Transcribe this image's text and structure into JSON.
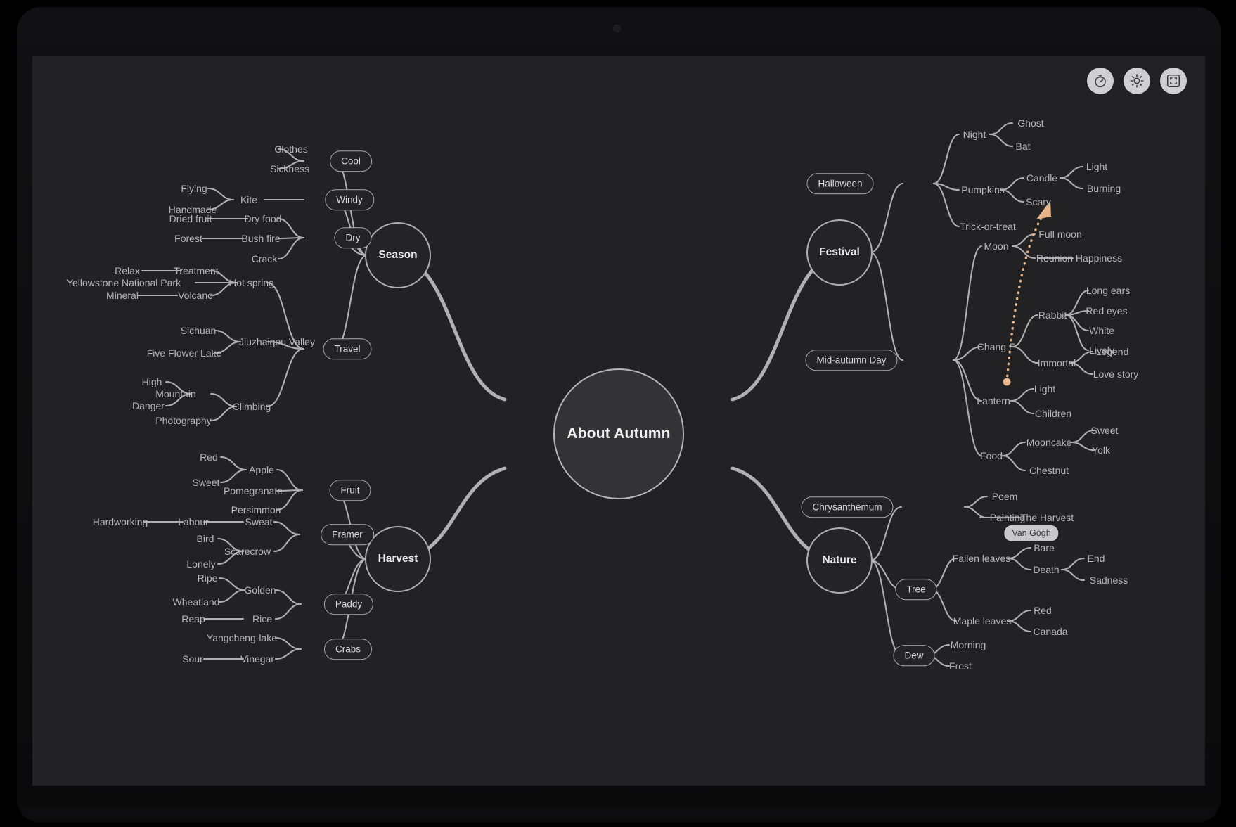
{
  "app": {
    "root_label": "About Autumn",
    "toolbar": [
      {
        "name": "timer-icon",
        "label": "Timer"
      },
      {
        "name": "brightness-icon",
        "label": "Brightness"
      },
      {
        "name": "fit-screen-icon",
        "label": "Fit to screen"
      }
    ],
    "colors": {
      "background": "#222224",
      "edge": "#b0b0b2",
      "text": "#b6b6ba",
      "accent": "#e8b68a",
      "badge_bg": "#c8c8cc"
    }
  },
  "relation": {
    "from": "Light",
    "to": "Light",
    "style": "dotted-arrow",
    "color": "#e8b68a"
  },
  "branches": {
    "season": {
      "label": "Season",
      "groups": [
        {
          "label": "Cool",
          "children": [
            {
              "label": "Clothes"
            },
            {
              "label": "Sickness"
            }
          ]
        },
        {
          "label": "Windy",
          "children": [
            {
              "label": "Kite",
              "children": [
                {
                  "label": "Flying"
                },
                {
                  "label": "Handmade"
                }
              ]
            }
          ]
        },
        {
          "label": "Dry",
          "children": [
            {
              "label": "Dry food",
              "children": [
                {
                  "label": "Dried fruit"
                }
              ]
            },
            {
              "label": "Bush fire",
              "children": [
                {
                  "label": "Forest"
                }
              ]
            },
            {
              "label": "Crack"
            }
          ]
        },
        {
          "label": "Travel",
          "children": [
            {
              "label": "Hot spring",
              "children": [
                {
                  "label": "Treatment",
                  "children": [
                    {
                      "label": "Relax"
                    }
                  ]
                },
                {
                  "label": "Yellowstone National Park"
                },
                {
                  "label": "Volcano",
                  "children": [
                    {
                      "label": "Mineral"
                    }
                  ]
                }
              ]
            },
            {
              "label": "Jiuzhaigou Valley",
              "children": [
                {
                  "label": "Sichuan"
                },
                {
                  "label": "Five Flower Lake"
                }
              ]
            },
            {
              "label": "Climbing",
              "children": [
                {
                  "label": "Mountain",
                  "children": [
                    {
                      "label": "High"
                    },
                    {
                      "label": "Danger"
                    }
                  ]
                },
                {
                  "label": "Photography"
                }
              ]
            }
          ]
        }
      ]
    },
    "harvest": {
      "label": "Harvest",
      "groups": [
        {
          "label": "Fruit",
          "children": [
            {
              "label": "Apple",
              "children": [
                {
                  "label": "Red"
                },
                {
                  "label": "Sweet"
                }
              ]
            },
            {
              "label": "Pomegranate"
            },
            {
              "label": "Persimmon"
            }
          ]
        },
        {
          "label": "Framer",
          "children": [
            {
              "label": "Sweat",
              "children": [
                {
                  "label": "Labour",
                  "children": [
                    {
                      "label": "Hardworking"
                    }
                  ]
                }
              ]
            },
            {
              "label": "Scarecrow",
              "children": [
                {
                  "label": "Bird"
                },
                {
                  "label": "Lonely"
                }
              ]
            }
          ]
        },
        {
          "label": "Paddy",
          "children": [
            {
              "label": "Golden",
              "children": [
                {
                  "label": "Ripe"
                },
                {
                  "label": "Wheatland"
                }
              ]
            },
            {
              "label": "Rice",
              "children": [
                {
                  "label": "Reap"
                }
              ]
            }
          ]
        },
        {
          "label": "Crabs",
          "children": [
            {
              "label": "Yangcheng-lake"
            },
            {
              "label": "Vinegar",
              "children": [
                {
                  "label": "Sour"
                }
              ]
            }
          ]
        }
      ]
    },
    "festival": {
      "label": "Festival",
      "groups": [
        {
          "label": "Halloween",
          "children": [
            {
              "label": "Night",
              "children": [
                {
                  "label": "Ghost"
                },
                {
                  "label": "Bat"
                }
              ]
            },
            {
              "label": "Pumpkins",
              "children": [
                {
                  "label": "Candle",
                  "children": [
                    {
                      "label": "Light"
                    },
                    {
                      "label": "Burning"
                    }
                  ]
                },
                {
                  "label": "Scary"
                }
              ]
            },
            {
              "label": "Trick-or-treat"
            }
          ]
        },
        {
          "label": "Mid-autumn Day",
          "children": [
            {
              "label": "Moon",
              "children": [
                {
                  "label": "Full moon"
                },
                {
                  "label": "Reunion",
                  "children": [
                    {
                      "label": "Happiness"
                    }
                  ]
                }
              ]
            },
            {
              "label": "Chang E",
              "children": [
                {
                  "label": "Rabbit",
                  "children": [
                    {
                      "label": "Long ears"
                    },
                    {
                      "label": "Red eyes"
                    },
                    {
                      "label": "White"
                    },
                    {
                      "label": "Lively"
                    }
                  ]
                },
                {
                  "label": "Immortal",
                  "children": [
                    {
                      "label": "Legend"
                    },
                    {
                      "label": "Love story"
                    }
                  ]
                }
              ]
            },
            {
              "label": "Lantern",
              "children": [
                {
                  "label": "Light"
                },
                {
                  "label": "Children"
                }
              ]
            },
            {
              "label": "Food",
              "children": [
                {
                  "label": "Mooncake",
                  "children": [
                    {
                      "label": "Sweet"
                    },
                    {
                      "label": "Yolk"
                    }
                  ]
                },
                {
                  "label": "Chestnut"
                }
              ]
            }
          ]
        }
      ]
    },
    "nature": {
      "label": "Nature",
      "groups": [
        {
          "label": "Chrysanthemum",
          "children": [
            {
              "label": "Poem"
            },
            {
              "label": "Painting",
              "children": [
                {
                  "label": "The Harvest",
                  "badge": "Van Gogh"
                }
              ]
            }
          ]
        },
        {
          "label": "Tree",
          "children": [
            {
              "label": "Fallen leaves",
              "children": [
                {
                  "label": "Bare"
                },
                {
                  "label": "Death",
                  "children": [
                    {
                      "label": "End"
                    },
                    {
                      "label": "Sadness"
                    }
                  ]
                }
              ]
            },
            {
              "label": "Maple leaves",
              "children": [
                {
                  "label": "Red"
                },
                {
                  "label": "Canada"
                }
              ]
            }
          ]
        },
        {
          "label": "Dew",
          "children": [
            {
              "label": "Morning"
            },
            {
              "label": "Frost"
            }
          ]
        }
      ]
    }
  },
  "nodes": {
    "root": "About Autumn",
    "season": "Season",
    "harvest": "Harvest",
    "festival": "Festival",
    "nature": "Nature",
    "cool": "Cool",
    "windy": "Windy",
    "dry": "Dry",
    "travel": "Travel",
    "clothes": "Clothes",
    "sickness": "Sickness",
    "kite": "Kite",
    "flying": "Flying",
    "handmade": "Handmade",
    "dryfood": "Dry food",
    "driedfruit": "Dried fruit",
    "bushfire": "Bush fire",
    "forest": "Forest",
    "crack": "Crack",
    "hotspring": "Hot spring",
    "treatment": "Treatment",
    "relax": "Relax",
    "yellowstone": "Yellowstone National Park",
    "volcano": "Volcano",
    "mineral": "Mineral",
    "jiuzhaigou": "Jiuzhaigou Valley",
    "sichuan": "Sichuan",
    "fiveflower": "Five Flower Lake",
    "climbing": "Climbing",
    "mountain": "Mountain",
    "high": "High",
    "danger": "Danger",
    "photography": "Photography",
    "fruit": "Fruit",
    "apple": "Apple",
    "red1": "Red",
    "sweet1": "Sweet",
    "pomegranate": "Pomegranate",
    "persimmon": "Persimmon",
    "framer": "Framer",
    "sweat": "Sweat",
    "labour": "Labour",
    "hardworking": "Hardworking",
    "scarecrow": "Scarecrow",
    "bird": "Bird",
    "lonely": "Lonely",
    "paddy": "Paddy",
    "golden": "Golden",
    "ripe": "Ripe",
    "wheatland": "Wheatland",
    "rice": "Rice",
    "reap": "Reap",
    "crabs": "Crabs",
    "yangcheng": "Yangcheng-lake",
    "vinegar": "Vinegar",
    "sour": "Sour",
    "halloween": "Halloween",
    "night": "Night",
    "ghost": "Ghost",
    "bat": "Bat",
    "pumpkins": "Pumpkins",
    "candle": "Candle",
    "light1": "Light",
    "burning": "Burning",
    "scary": "Scary",
    "trick": "Trick-or-treat",
    "midautumn": "Mid-autumn Day",
    "moon": "Moon",
    "fullmoon": "Full moon",
    "reunion": "Reunion",
    "happiness": "Happiness",
    "change": "Chang E",
    "rabbit": "Rabbit",
    "longears": "Long ears",
    "redeyes": "Red eyes",
    "white": "White",
    "lively": "Lively",
    "immortal": "Immortal",
    "legend": "Legend",
    "lovestory": "Love story",
    "lantern": "Lantern",
    "light2": "Light",
    "children": "Children",
    "food": "Food",
    "mooncake": "Mooncake",
    "sweet2": "Sweet",
    "yolk": "Yolk",
    "chestnut": "Chestnut",
    "chrysanthemum": "Chrysanthemum",
    "poem": "Poem",
    "painting": "Painting",
    "theharvest": "The Harvest",
    "vangogh": "Van Gogh",
    "tree": "Tree",
    "fallenleaves": "Fallen leaves",
    "bare": "Bare",
    "death": "Death",
    "end": "End",
    "sadness": "Sadness",
    "mapleleaves": "Maple leaves",
    "red2": "Red",
    "canada": "Canada",
    "dew": "Dew",
    "morning": "Morning",
    "frost": "Frost"
  }
}
